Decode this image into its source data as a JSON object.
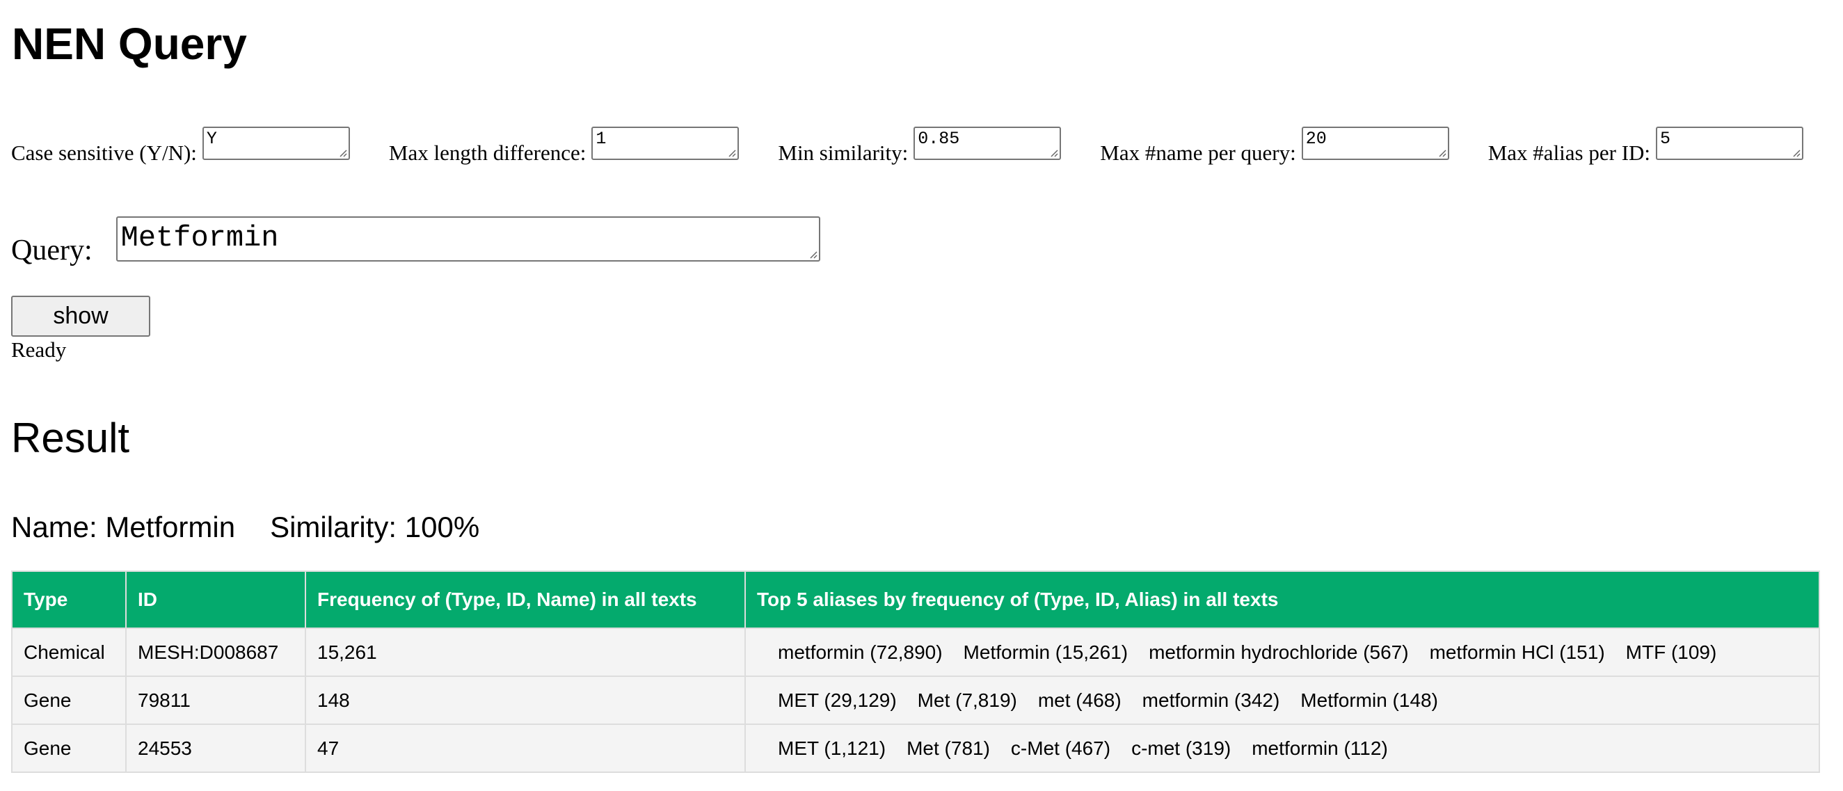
{
  "page": {
    "title": "NEN Query"
  },
  "params": [
    {
      "label": "Case sensitive (Y/N):",
      "value": "Y"
    },
    {
      "label": "Max length difference:",
      "value": "1"
    },
    {
      "label": "Min similarity:",
      "value": "0.85"
    },
    {
      "label": "Max #name per query:",
      "value": "20"
    },
    {
      "label": "Max #alias per ID:",
      "value": "5"
    }
  ],
  "query": {
    "label": "Query:",
    "value": "Metformin"
  },
  "actions": {
    "show_label": "show",
    "status": "Ready"
  },
  "result": {
    "heading": "Result",
    "name_text": "Name: Metformin",
    "similarity_text": "Similarity: 100%",
    "table": {
      "headers": [
        "Type",
        "ID",
        "Frequency of (Type, ID, Name) in all texts",
        "Top 5 aliases by frequency of (Type, ID, Alias) in all texts"
      ],
      "rows": [
        {
          "type": "Chemical",
          "id": "MESH:D008687",
          "frequency": "15,261",
          "aliases": [
            "metformin (72,890)",
            "Metformin (15,261)",
            "metformin hydrochloride (567)",
            "metformin HCl (151)",
            "MTF (109)"
          ]
        },
        {
          "type": "Gene",
          "id": "79811",
          "frequency": "148",
          "aliases": [
            "MET (29,129)",
            "Met (7,819)",
            "met (468)",
            "metformin (342)",
            "Metformin (148)"
          ]
        },
        {
          "type": "Gene",
          "id": "24553",
          "frequency": "47",
          "aliases": [
            "MET (1,121)",
            "Met (781)",
            "c-Met (467)",
            "c-met (319)",
            "metformin (112)"
          ]
        }
      ]
    }
  },
  "icons": {
    "resize_grip": "resize-grip-icon"
  },
  "colors": {
    "table_header_bg": "#04aa6d",
    "table_header_text": "#ffffff",
    "table_row_bg": "#f4f4f4",
    "table_border": "#dddddd",
    "button_bg": "#efefef"
  }
}
